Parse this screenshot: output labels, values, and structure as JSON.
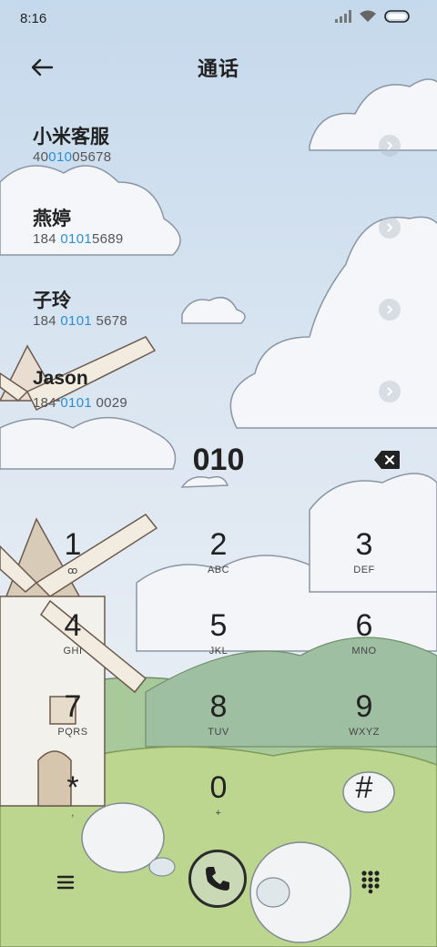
{
  "status": {
    "time": "8:16"
  },
  "header": {
    "title": "通话"
  },
  "results": [
    {
      "name": "小米客服",
      "num_pre": "40",
      "num_hl": "010",
      "num_post": "05678"
    },
    {
      "name": "燕婷",
      "num_pre": "184 ",
      "num_hl": "0101",
      "num_post": "5689"
    },
    {
      "name": "子玲",
      "num_pre": "184 ",
      "num_hl": "0101",
      "num_post": " 5678"
    },
    {
      "name": "Jason",
      "num_pre": "184 ",
      "num_hl": "0101",
      "num_post": " 0029"
    }
  ],
  "dialer": {
    "typed": "010",
    "keys": [
      {
        "digit": "1",
        "letters": "ꝏ"
      },
      {
        "digit": "2",
        "letters": "ABC"
      },
      {
        "digit": "3",
        "letters": "DEF"
      },
      {
        "digit": "4",
        "letters": "GHI"
      },
      {
        "digit": "5",
        "letters": "JKL"
      },
      {
        "digit": "6",
        "letters": "MNO"
      },
      {
        "digit": "7",
        "letters": "PQRS"
      },
      {
        "digit": "8",
        "letters": "TUV"
      },
      {
        "digit": "9",
        "letters": "WXYZ"
      },
      {
        "digit": "*",
        "letters": ","
      },
      {
        "digit": "0",
        "letters": "+"
      },
      {
        "digit": "#",
        "letters": ""
      }
    ]
  },
  "icons": {
    "back": "back-arrow-icon",
    "backspace": "backspace-icon",
    "menu": "menu-icon",
    "call": "phone-icon",
    "dialpad": "dialpad-icon"
  },
  "colors": {
    "highlight": "#2a8fd6",
    "call_button": "#c9d8b5",
    "sky": "#c9dced",
    "grass": "#b9d48f"
  }
}
